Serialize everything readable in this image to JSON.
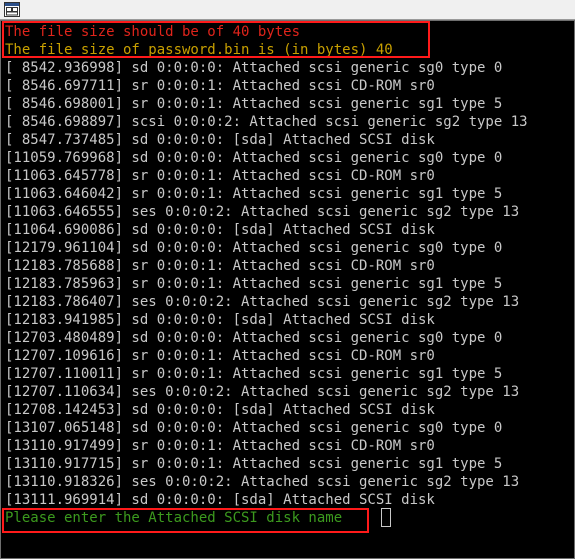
{
  "titlebar": {
    "icon": "console-window-icon"
  },
  "highlight_color": "#ff1a1a",
  "messages": {
    "size_expected": "The file size should be of 40 bytes",
    "size_actual": "The file size of password.bin is (in bytes) 40"
  },
  "log_lines": [
    "[ 8542.936998] sd 0:0:0:0: Attached scsi generic sg0 type 0",
    "[ 8546.697711] sr 0:0:0:1: Attached scsi CD-ROM sr0",
    "[ 8546.698001] sr 0:0:0:1: Attached scsi generic sg1 type 5",
    "[ 8546.698897] scsi 0:0:0:2: Attached scsi generic sg2 type 13",
    "[ 8547.737485] sd 0:0:0:0: [sda] Attached SCSI disk",
    "[11059.769968] sd 0:0:0:0: Attached scsi generic sg0 type 0",
    "[11063.645778] sr 0:0:0:1: Attached scsi CD-ROM sr0",
    "[11063.646042] sr 0:0:0:1: Attached scsi generic sg1 type 5",
    "[11063.646555] ses 0:0:0:2: Attached scsi generic sg2 type 13",
    "[11064.690086] sd 0:0:0:0: [sda] Attached SCSI disk",
    "[12179.961104] sd 0:0:0:0: Attached scsi generic sg0 type 0",
    "[12183.785688] sr 0:0:0:1: Attached scsi CD-ROM sr0",
    "[12183.785963] sr 0:0:0:1: Attached scsi generic sg1 type 5",
    "[12183.786407] ses 0:0:0:2: Attached scsi generic sg2 type 13",
    "[12183.941985] sd 0:0:0:0: [sda] Attached SCSI disk",
    "[12703.480489] sd 0:0:0:0: Attached scsi generic sg0 type 0",
    "[12707.109616] sr 0:0:0:1: Attached scsi CD-ROM sr0",
    "[12707.110011] sr 0:0:0:1: Attached scsi generic sg1 type 5",
    "[12707.110634] ses 0:0:0:2: Attached scsi generic sg2 type 13",
    "[12708.142453] sd 0:0:0:0: [sda] Attached SCSI disk",
    "[13107.065148] sd 0:0:0:0: Attached scsi generic sg0 type 0",
    "[13110.917499] sr 0:0:0:1: Attached scsi CD-ROM sr0",
    "[13110.917715] sr 0:0:0:1: Attached scsi generic sg1 type 5",
    "[13110.918326] ses 0:0:0:2: Attached scsi generic sg2 type 13",
    "[13111.969914] sd 0:0:0:0: [sda] Attached SCSI disk"
  ],
  "prompt": {
    "text": "Please enter the Attached SCSI disk name"
  }
}
